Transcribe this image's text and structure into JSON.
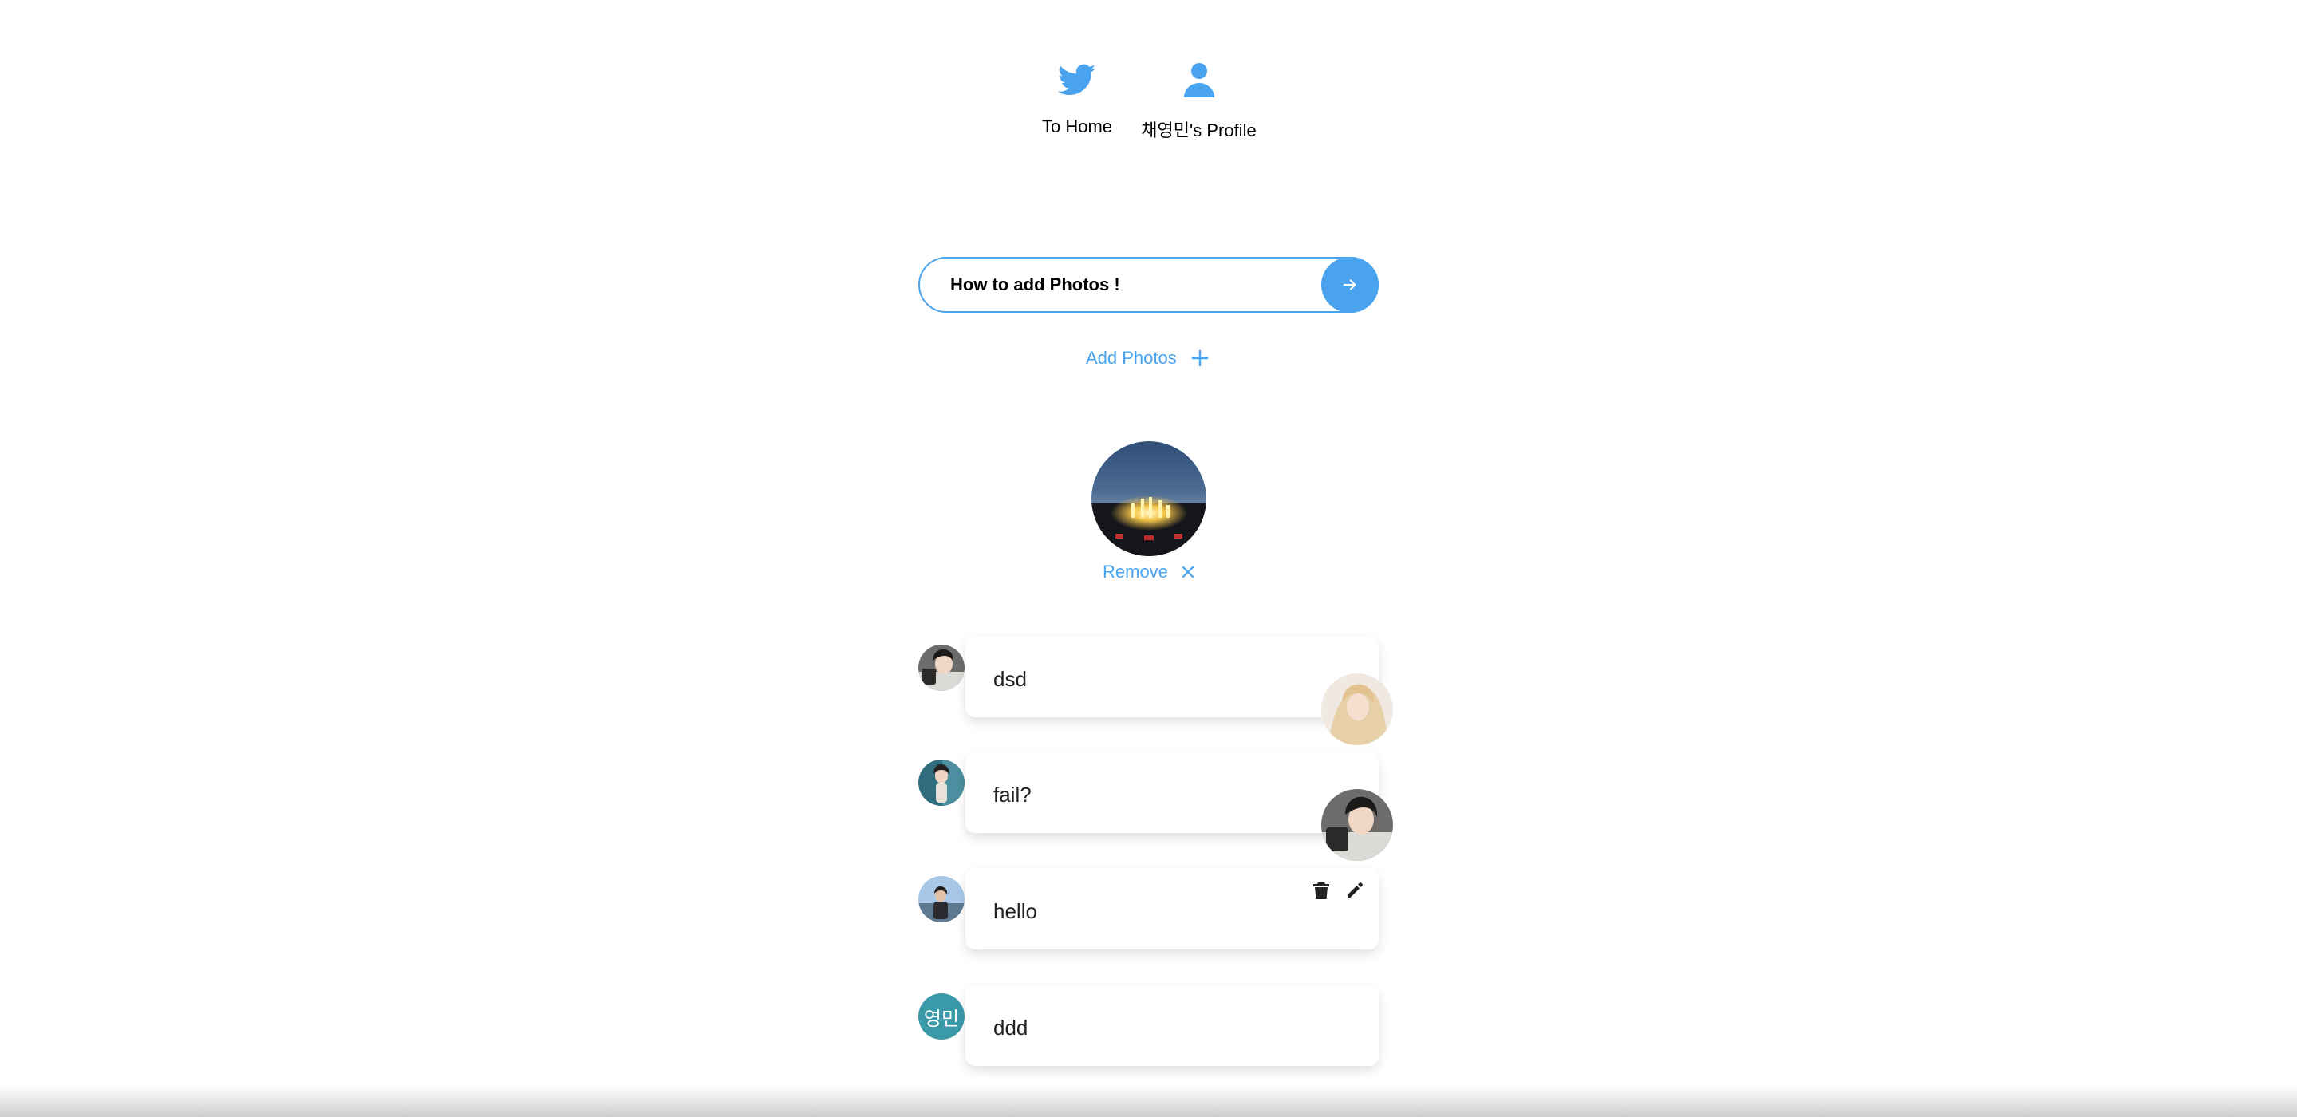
{
  "nav": {
    "home_label": "To Home",
    "profile_label": "채영민's Profile",
    "home_icon": "twitter-bird-icon",
    "profile_icon": "user-icon"
  },
  "composer": {
    "value": "How to add Photos !",
    "placeholder": "",
    "submit_icon": "arrow-right-icon"
  },
  "add_photos": {
    "label": "Add Photos",
    "icon": "plus-icon"
  },
  "preview": {
    "remove_label": "Remove",
    "remove_icon": "close-icon"
  },
  "tweets": [
    {
      "text": "dsd",
      "author_avatar": "photo",
      "attachment": "photo"
    },
    {
      "text": "fail?",
      "author_avatar": "photo",
      "attachment": "photo"
    },
    {
      "text": "hello",
      "author_avatar": "photo",
      "actions": [
        "trash-icon",
        "pencil-icon"
      ]
    },
    {
      "text": "ddd",
      "author_avatar_text": "영민"
    }
  ],
  "colors": {
    "accent": "#4aa3ef",
    "text_avatar_bg": "#3a9aa8"
  }
}
